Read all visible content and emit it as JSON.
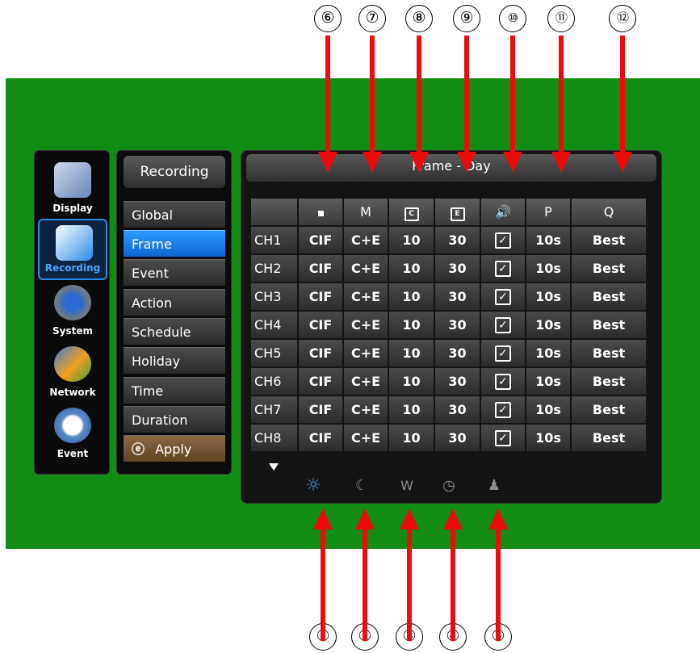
{
  "annotations": {
    "top": [
      "⑥",
      "⑦",
      "⑧",
      "⑨",
      "⑩",
      "⑪",
      "⑫"
    ],
    "bottom": [
      "①",
      "②",
      "③",
      "④",
      "⑤"
    ]
  },
  "sidebar": {
    "items": [
      {
        "label": "Display",
        "icon": "monitor-icon"
      },
      {
        "label": "Recording",
        "icon": "recording-icon"
      },
      {
        "label": "System",
        "icon": "system-icon"
      },
      {
        "label": "Network",
        "icon": "network-icon"
      },
      {
        "label": "Event",
        "icon": "event-clock-icon"
      }
    ],
    "active": "Recording"
  },
  "menu": {
    "title": "Recording",
    "items": [
      "Global",
      "Frame",
      "Event",
      "Action",
      "Schedule",
      "Holiday",
      "Time",
      "Duration"
    ],
    "active": "Frame",
    "apply_label": "Apply"
  },
  "panel": {
    "title": "Frame - Day",
    "headers": {
      "m": "M",
      "p": "P",
      "q": "Q",
      "c_icon": "C",
      "e_icon": "E"
    },
    "rows": [
      {
        "ch": "CH1",
        "res": "CIF",
        "mode": "C+E",
        "c": "10",
        "e": "30",
        "audio": "✓",
        "p": "10s",
        "q": "Best"
      },
      {
        "ch": "CH2",
        "res": "CIF",
        "mode": "C+E",
        "c": "10",
        "e": "30",
        "audio": "✓",
        "p": "10s",
        "q": "Best"
      },
      {
        "ch": "CH3",
        "res": "CIF",
        "mode": "C+E",
        "c": "10",
        "e": "30",
        "audio": "✓",
        "p": "10s",
        "q": "Best"
      },
      {
        "ch": "CH4",
        "res": "CIF",
        "mode": "C+E",
        "c": "10",
        "e": "30",
        "audio": "✓",
        "p": "10s",
        "q": "Best"
      },
      {
        "ch": "CH5",
        "res": "CIF",
        "mode": "C+E",
        "c": "10",
        "e": "30",
        "audio": "✓",
        "p": "10s",
        "q": "Best"
      },
      {
        "ch": "CH6",
        "res": "CIF",
        "mode": "C+E",
        "c": "10",
        "e": "30",
        "audio": "✓",
        "p": "10s",
        "q": "Best"
      },
      {
        "ch": "CH7",
        "res": "CIF",
        "mode": "C+E",
        "c": "10",
        "e": "30",
        "audio": "✓",
        "p": "10s",
        "q": "Best"
      },
      {
        "ch": "CH8",
        "res": "CIF",
        "mode": "C+E",
        "c": "10",
        "e": "30",
        "audio": "✓",
        "p": "10s",
        "q": "Best"
      }
    ],
    "modes": [
      {
        "icon": "sun-icon",
        "glyph": "☼",
        "active": true
      },
      {
        "icon": "moon-icon",
        "glyph": "☾",
        "active": false
      },
      {
        "icon": "weekend-icon",
        "glyph": "W",
        "active": false
      },
      {
        "icon": "clock-icon",
        "glyph": "◷",
        "active": false
      },
      {
        "icon": "person-icon",
        "glyph": "♟",
        "active": false
      }
    ]
  },
  "colors": {
    "background": "#138c13",
    "arrow": "#ee0b0b",
    "active_blue": "#1a7ee8"
  }
}
